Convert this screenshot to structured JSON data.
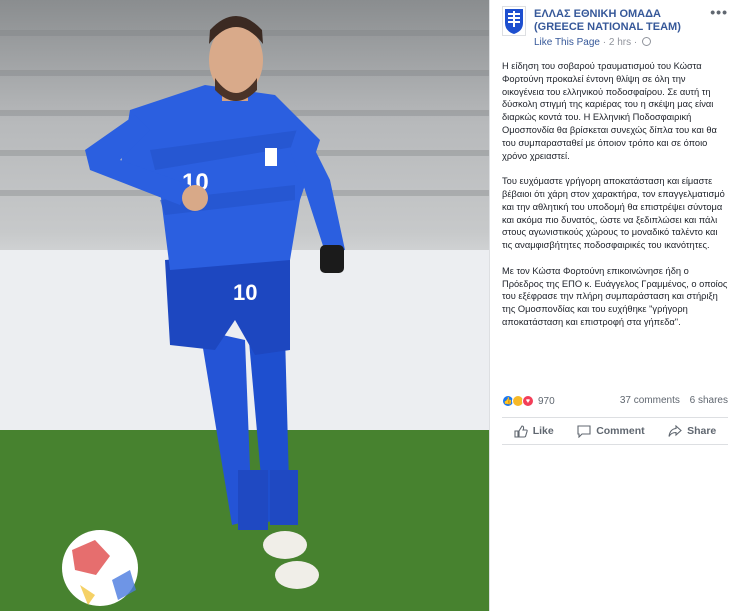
{
  "post": {
    "page_name": "ΕΛΛΑΣ ΕΘΝΙΚΗ ΟΜΑΔΑ (GREECE NATIONAL TEAM)",
    "like_page_label": "Like This Page",
    "separator": "·",
    "timestamp": "2 hrs",
    "more_label": "•••",
    "paragraphs": [
      "Η είδηση του σοβαρού τραυματισμού του Κώστα Φορτούνη προκαλεί έντονη θλίψη σε όλη την οικογένεια του ελληνικού ποδοσφαίρου. Σε αυτή τη δύσκολη στιγμή της καριέρας του η σκέψη μας είναι διαρκώς κοντά του. Η Ελληνική Ποδοσφαιρική Ομοσπονδία θα βρίσκεται συνεχώς δίπλα του και θα του συμπαρασταθεί με όποιον τρόπο και σε όποιο χρόνο χρειαστεί.",
      "Του ευχόμαστε γρήγορη αποκατάσταση και είμαστε βέβαιοι ότι χάρη στον χαρακτήρα, τον επαγγελματισμό και την αθλητική του υποδομή θα επιστρέψει σύντομα και ακόμα πιο δυνατός, ώστε να ξεδιπλώσει και πάλι στους αγωνιστικούς χώρους το μοναδικό ταλέντο και τις αναμφισβήτητες ποδοσφαιρικές του ικανότητες.",
      "Με τον Κώστα Φορτούνη επικοινώνησε ήδη ο Πρόεδρος της ΕΠΟ κ. Ευάγγελος Γραμμένος, ο οποίος του εξέφρασε την πλήρη συμπαράσταση και στήριξη της Ομοσπονδίας και του ευχήθηκε \"γρήγορη αποκατάσταση και επιστροφή στα γήπεδα\"."
    ],
    "reaction_count": "970",
    "comments_count": "37 comments",
    "shares_count": "6 shares",
    "actions": {
      "like": "Like",
      "comment": "Comment",
      "share": "Share"
    }
  },
  "photo": {
    "jersey_number": "10",
    "shorts_number": "10"
  },
  "colors": {
    "link": "#365899",
    "muted": "#90949c",
    "kit_blue": "#1e4fcf",
    "pitch_green": "#3f7a2a"
  },
  "icons": {
    "reactions": [
      "like-reaction-icon",
      "sad-reaction-icon",
      "love-reaction-icon"
    ],
    "actions": [
      "thumbs-up-icon",
      "speech-bubble-icon",
      "share-arrow-icon"
    ]
  }
}
